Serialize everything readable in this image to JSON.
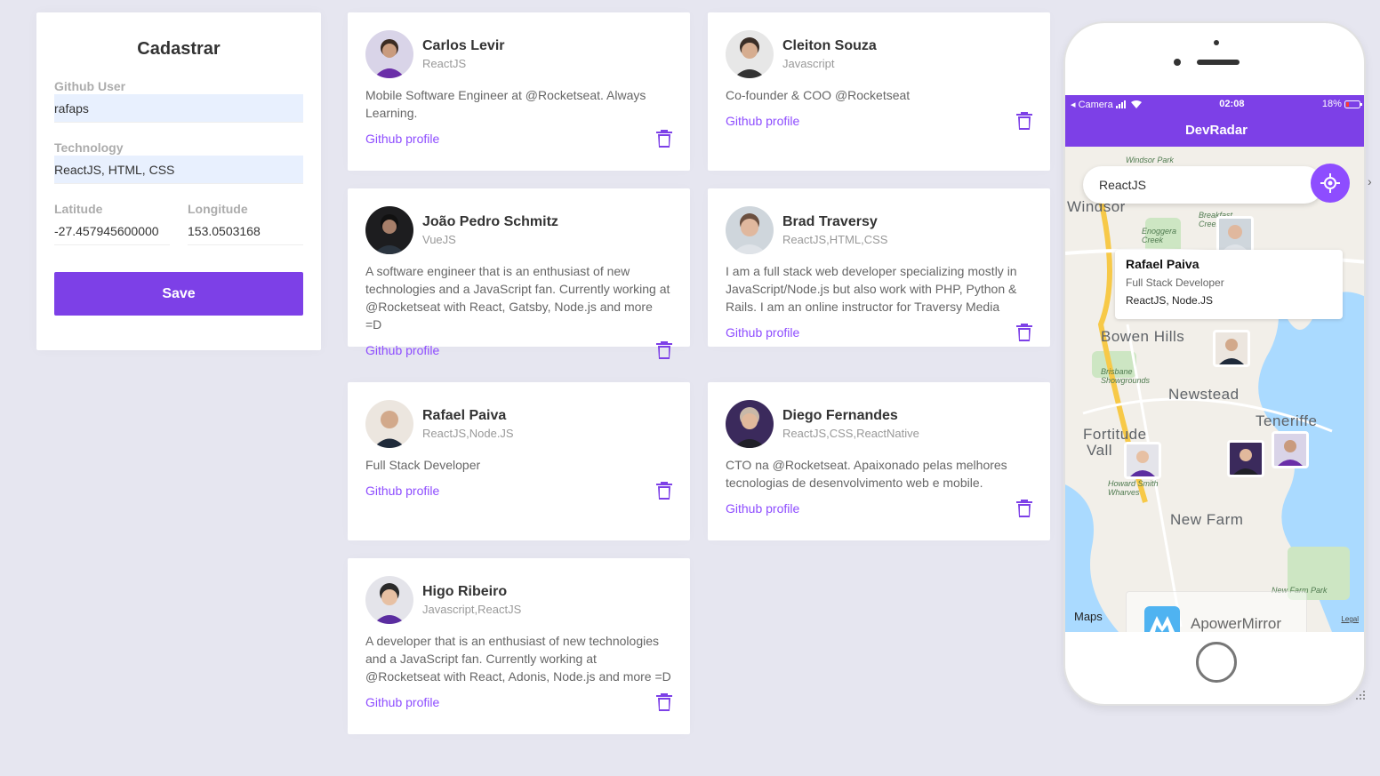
{
  "form": {
    "title": "Cadastrar",
    "github_user_label": "Github User",
    "github_user_value": "rafaps",
    "technology_label": "Technology",
    "technology_value": "ReactJS, HTML, CSS",
    "latitude_label": "Latitude",
    "latitude_value": "-27.457945600000",
    "longitude_label": "Longitude",
    "longitude_value": "153.0503168",
    "save_label": "Save"
  },
  "devs": [
    {
      "name": "Carlos Levir",
      "techs": "ReactJS",
      "bio": "Mobile Software Engineer at @Rocketseat. Always Learning.",
      "link": "Github profile"
    },
    {
      "name": "Cleiton Souza",
      "techs": "Javascript",
      "bio": "Co-founder & COO @Rocketseat",
      "link": "Github profile"
    },
    {
      "name": "João Pedro Schmitz",
      "techs": "VueJS",
      "bio": "A software engineer that is an enthusiast of new technologies and a JavaScript fan. Currently working at @Rocketseat with React, Gatsby, Node.js and more =D",
      "link": "Github profile"
    },
    {
      "name": "Brad Traversy",
      "techs": "ReactJS,HTML,CSS",
      "bio": "I am a full stack web developer specializing mostly in JavaScript/Node.js but also work with PHP, Python & Rails. I am an online instructor for Traversy Media",
      "link": "Github profile"
    },
    {
      "name": "Rafael Paiva",
      "techs": "ReactJS,Node.JS",
      "bio": "Full Stack Developer",
      "link": "Github profile"
    },
    {
      "name": "Diego Fernandes",
      "techs": "ReactJS,CSS,ReactNative",
      "bio": "CTO na @Rocketseat. Apaixonado pelas melhores tecnologias de desenvolvimento web e mobile.",
      "link": "Github profile"
    },
    {
      "name": "Higo Ribeiro",
      "techs": "Javascript,ReactJS",
      "bio": "A developer that is an enthusiast of new technologies and a JavaScript fan. Currently working at @Rocketseat with React, Adonis, Node.js and more =D",
      "link": "Github profile"
    }
  ],
  "phone": {
    "status_left": "◂ Camera",
    "status_time": "02:08",
    "status_battery": "18%",
    "app_title": "DevRadar",
    "search_value": "ReactJS",
    "callout_name": "Rafael Paiva",
    "callout_bio": "Full Stack Developer",
    "callout_techs": "ReactJS, Node.JS",
    "map_labels": {
      "windsor": "Windsor",
      "bowen_hills": "Bowen Hills",
      "newstead": "Newstead",
      "teneriffe": "Teneriffe",
      "fortitude_1": "Fortitude",
      "fortitude_2": "Vall",
      "new_farm": "New Farm",
      "windsor_park": "Windsor Park",
      "enoggera": "Enoggera Creek",
      "breakfast": "Breakfast Creek",
      "showgrounds": "Brisbane Showgrounds",
      "howard_smith": "Howard Smith Wharves",
      "new_farm_park": "New Farm Park"
    },
    "maps_brand": "Maps",
    "legal": "Legal",
    "watermark_text": "ApowerMirror"
  },
  "colors": {
    "accent": "#7d40e7",
    "link": "#8e4dff",
    "background": "#e6e6f0"
  },
  "icons": [
    "trash-icon",
    "gps-target-icon",
    "wifi-icon",
    "signal-icon",
    "battery-icon",
    "chevron-right-icon"
  ]
}
